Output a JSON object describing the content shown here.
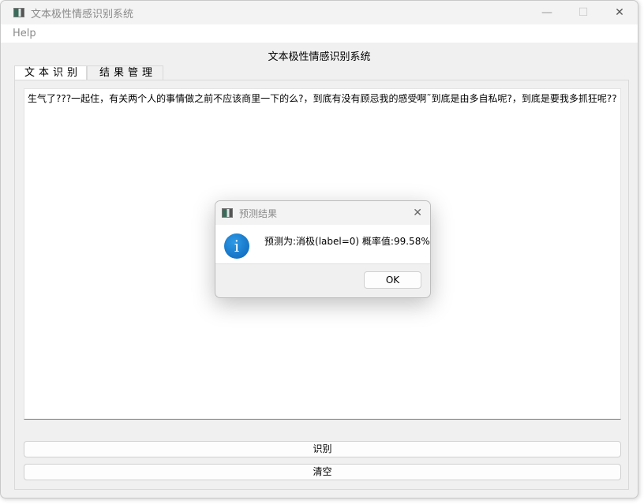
{
  "window": {
    "title": "文本极性情感识别系统",
    "minimize": "—",
    "maximize": "☐",
    "close": "✕"
  },
  "menu": {
    "help": "Help"
  },
  "heading": "文本极性情感识别系统",
  "tabs": [
    {
      "label": "文本识别"
    },
    {
      "label": "结果管理"
    }
  ],
  "text_input": {
    "value": "生气了???一起住，有关两个人的事情做之前不应该商里一下的么?，到底有没有顾忌我的感受啊˜到底是由多自私呢?，到底是要我多抓狂呢??"
  },
  "buttons": {
    "recognize": "识别",
    "clear": "清空"
  },
  "dialog": {
    "title": "预测结果",
    "message": "预测为:消极(label=0) 概率值:99.58%",
    "ok": "OK",
    "close": "✕",
    "icon": "info-icon"
  }
}
